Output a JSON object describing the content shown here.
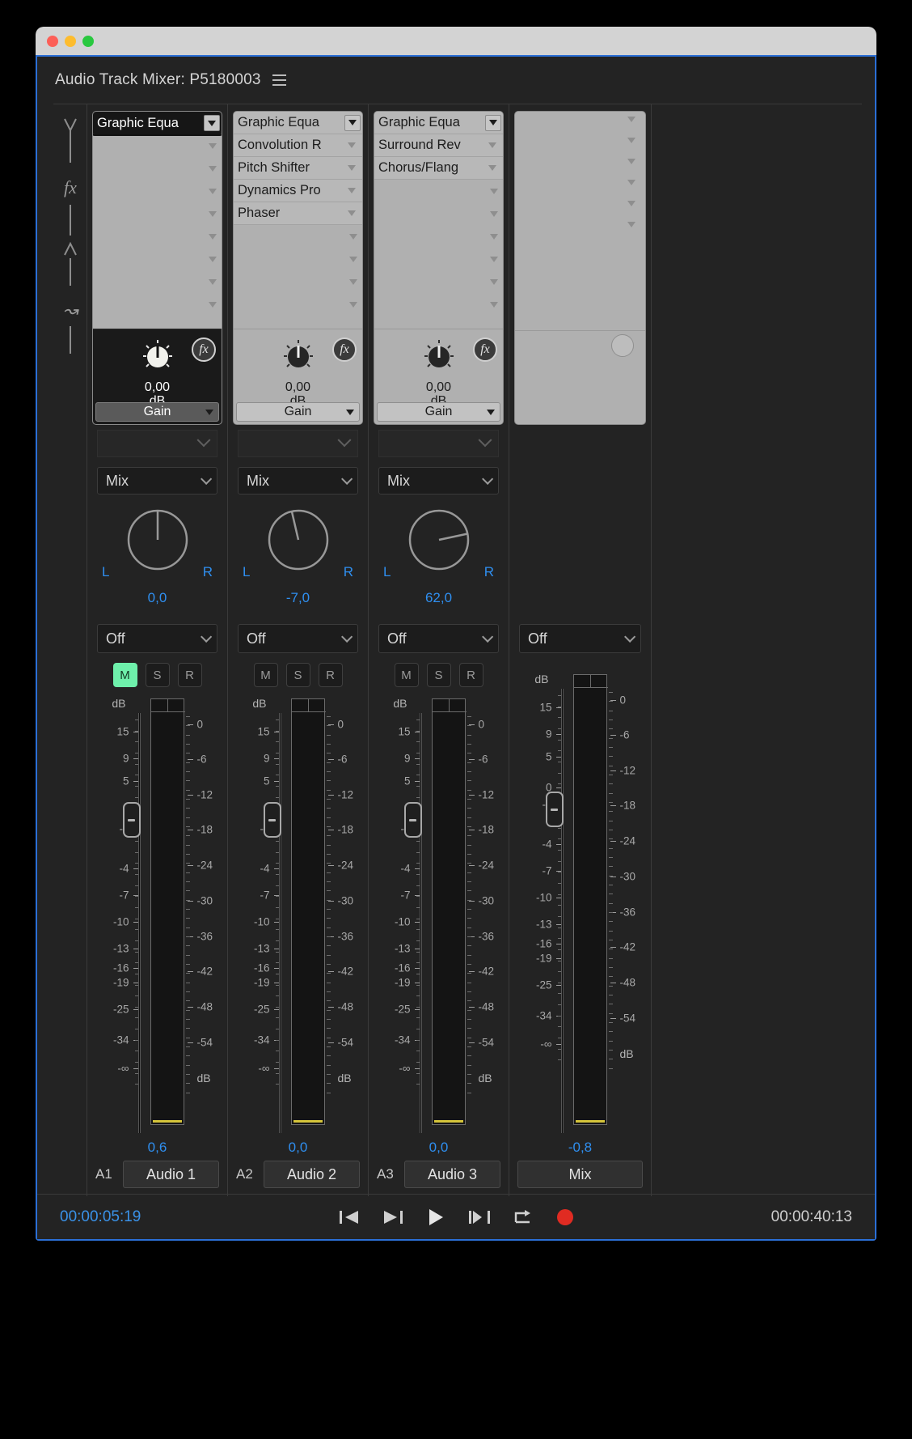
{
  "window": {
    "traffic_lights": [
      "close",
      "minimize",
      "maximize"
    ]
  },
  "header": {
    "title": "Audio Track Mixer: P5180003",
    "menu_icon": "hamburger-menu-icon"
  },
  "rail": {
    "fx_label": "fx"
  },
  "channels": [
    {
      "id": "audio1",
      "track_number": "A1",
      "track_name": "Audio 1",
      "effects": [
        {
          "label": "Graphic Equa",
          "state": "selected"
        },
        {
          "label": "",
          "state": "empty"
        },
        {
          "label": "",
          "state": "empty"
        },
        {
          "label": "",
          "state": "empty"
        },
        {
          "label": "",
          "state": "empty"
        },
        {
          "label": "",
          "state": "empty"
        },
        {
          "label": "",
          "state": "empty"
        },
        {
          "label": "",
          "state": "empty"
        },
        {
          "label": "",
          "state": "empty"
        },
        {
          "label": "",
          "state": "empty"
        }
      ],
      "gain": {
        "value": "0,00",
        "unit": "dB",
        "selector": "Gain",
        "fx_badge": "fx",
        "selected": true,
        "knob_angle": 0
      },
      "send_target": "Mix",
      "pan": {
        "left": "L",
        "right": "R",
        "value": "0,0",
        "angle": 0
      },
      "automation_mode": "Off",
      "buttons": {
        "mute": "M",
        "solo": "S",
        "record": "R",
        "mute_on": true,
        "solo_on": false,
        "record_on": false
      },
      "volume": "0,6"
    },
    {
      "id": "audio2",
      "track_number": "A2",
      "track_name": "Audio 2",
      "effects": [
        {
          "label": "Graphic Equa",
          "state": "filled"
        },
        {
          "label": "Convolution R",
          "state": "filled"
        },
        {
          "label": "Pitch Shifter",
          "state": "filled"
        },
        {
          "label": "Dynamics Pro",
          "state": "filled"
        },
        {
          "label": "Phaser",
          "state": "filled"
        },
        {
          "label": "",
          "state": "empty"
        },
        {
          "label": "",
          "state": "empty"
        },
        {
          "label": "",
          "state": "empty"
        },
        {
          "label": "",
          "state": "empty"
        },
        {
          "label": "",
          "state": "empty"
        }
      ],
      "gain": {
        "value": "0,00",
        "unit": "dB",
        "selector": "Gain",
        "fx_badge": "fx",
        "selected": false,
        "knob_angle": 0
      },
      "send_target": "Mix",
      "pan": {
        "left": "L",
        "right": "R",
        "value": "-7,0",
        "angle": -7
      },
      "automation_mode": "Off",
      "buttons": {
        "mute": "M",
        "solo": "S",
        "record": "R",
        "mute_on": false,
        "solo_on": false,
        "record_on": false
      },
      "volume": "0,0"
    },
    {
      "id": "audio3",
      "track_number": "A3",
      "track_name": "Audio 3",
      "effects": [
        {
          "label": "Graphic Equa",
          "state": "filled"
        },
        {
          "label": "Surround Rev",
          "state": "filled"
        },
        {
          "label": "Chorus/Flang",
          "state": "filled"
        },
        {
          "label": "",
          "state": "empty"
        },
        {
          "label": "",
          "state": "empty"
        },
        {
          "label": "",
          "state": "empty"
        },
        {
          "label": "",
          "state": "empty"
        },
        {
          "label": "",
          "state": "empty"
        },
        {
          "label": "",
          "state": "empty"
        },
        {
          "label": "",
          "state": "empty"
        }
      ],
      "gain": {
        "value": "0,00",
        "unit": "dB",
        "selector": "Gain",
        "fx_badge": "fx",
        "selected": false,
        "knob_angle": 0
      },
      "send_target": "Mix",
      "pan": {
        "left": "L",
        "right": "R",
        "value": "62,0",
        "angle": 62
      },
      "automation_mode": "Off",
      "buttons": {
        "mute": "M",
        "solo": "S",
        "record": "R",
        "mute_on": false,
        "solo_on": false,
        "record_on": false
      },
      "volume": "0,0"
    },
    {
      "id": "master",
      "track_number": "",
      "track_name": "Mix",
      "is_master": true,
      "automation_mode": "Off",
      "volume": "-0,8"
    }
  ],
  "fader_scale": {
    "cap": "dB",
    "labels": [
      "15",
      "9",
      "5",
      "0",
      "-1",
      "-4",
      "-7",
      "-10",
      "-13",
      "-16",
      "-19",
      "-25",
      "-34",
      "-∞"
    ]
  },
  "meter_scale": {
    "cap": "dB",
    "labels": [
      "0",
      "-6",
      "-12",
      "-18",
      "-24",
      "-30",
      "-36",
      "-42",
      "-48",
      "-54"
    ]
  },
  "transport": {
    "current_time": "00:00:05:19",
    "duration": "00:00:40:13",
    "buttons": [
      {
        "name": "go-to-in-point",
        "icon": "skip-to-start"
      },
      {
        "name": "go-to-out-point",
        "icon": "skip-forward"
      },
      {
        "name": "play-stop",
        "icon": "play"
      },
      {
        "name": "go-to-next-marker",
        "icon": "skip-to-end"
      },
      {
        "name": "loop",
        "icon": "loop"
      },
      {
        "name": "record",
        "icon": "record-dot"
      }
    ]
  },
  "colors": {
    "accent_blue": "#2f8ff0",
    "mute_green": "#6ef0ab",
    "record_red": "#e02b22",
    "panel_bg": "#232323",
    "rack_gray": "#b0b0b0",
    "focus_border": "#2b6fd6"
  }
}
